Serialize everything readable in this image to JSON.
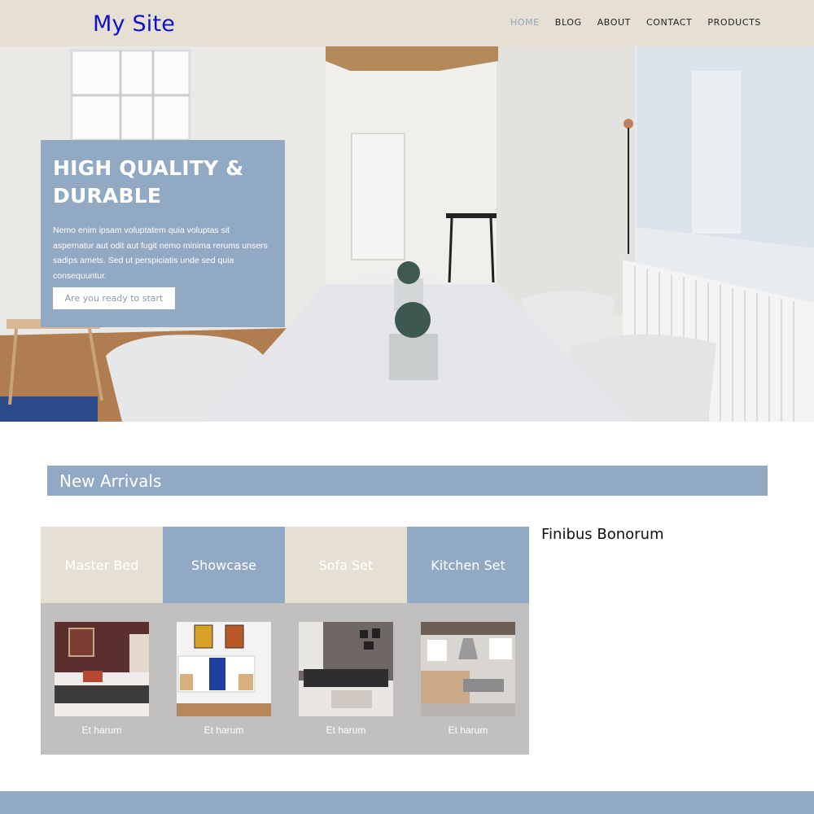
{
  "header": {
    "logo": "My Site",
    "nav": [
      "HOME",
      "BLOG",
      "ABOUT",
      "CONTACT",
      "PRODUCTS"
    ]
  },
  "hero": {
    "title_line1": "HIGH QUALITY &",
    "title_line2": "DURABLE",
    "text": "Nemo enim ipsam voluptatem quia voluptas sit aspernatur aut odit aut fugit nemo minima rerums unsers sadips amets. Sed ut perspiciatis unde sed quia consequuntur.",
    "button": "Are you ready to start"
  },
  "arrivals": {
    "title": "New Arrivals",
    "side_heading": "Finibus Bonorum",
    "tabs": [
      "Master Bed",
      "Showcase",
      "Sofa Set",
      "Kitchen Set"
    ],
    "captions": [
      "Et harum",
      "Et harum",
      "Et harum",
      "Et harum"
    ]
  },
  "colors": {
    "header_bg": "#e6e0d4",
    "accent_blue": "#92a9c3",
    "beige": "#e6e0d4",
    "logo": "#1010c8",
    "product_panel": "#c2bfbf"
  }
}
